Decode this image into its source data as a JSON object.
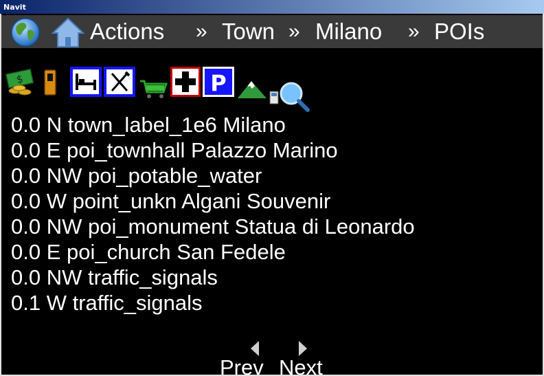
{
  "window": {
    "title": "Navit"
  },
  "breadcrumb": {
    "items": [
      {
        "label": "Actions"
      },
      {
        "label": "Town"
      },
      {
        "label": "Milano"
      },
      {
        "label": "POIs"
      }
    ],
    "separator": "»"
  },
  "icons": {
    "globe": "globe-icon",
    "home": "home-icon",
    "categories": [
      "money-icon",
      "fuel-icon",
      "hotel-icon",
      "restaurant-icon",
      "shopping-icon",
      "hospital-icon",
      "parking-icon",
      "mountain-icon",
      "phone-icon",
      "search-icon"
    ]
  },
  "results": [
    {
      "text": "0.0 N town_label_1e6 Milano"
    },
    {
      "text": "0.0 E poi_townhall Palazzo Marino"
    },
    {
      "text": "0.0 NW poi_potable_water"
    },
    {
      "text": "0.0 W point_unkn Algani Souvenir"
    },
    {
      "text": "0.0 NW poi_monument Statua di Leonardo"
    },
    {
      "text": "0.0 E poi_church San Fedele"
    },
    {
      "text": "0.0 NW traffic_signals"
    },
    {
      "text": "0.1 W traffic_signals"
    }
  ],
  "pager": {
    "prev_label": "Prev",
    "next_label": "Next"
  },
  "colors": {
    "background": "#000000",
    "bar": "#3a3a3a",
    "text": "#ffffff",
    "highlight": "#0000ff"
  }
}
